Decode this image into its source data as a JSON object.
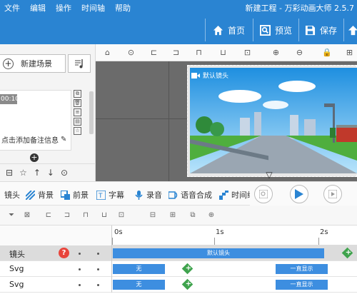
{
  "menu": [
    "文件",
    "编辑",
    "操作",
    "时间轴",
    "帮助"
  ],
  "window_title": "新建工程 - 万彩动画大师 2.5.7",
  "top_buttons": {
    "home": "首页",
    "preview": "预览",
    "save": "保存"
  },
  "left_panel": {
    "new_scene": "新建场景",
    "scene_time": "00:10",
    "note_hint": "点击添加备注信息"
  },
  "canvas": {
    "lens_label": "默认镜头"
  },
  "tabs": [
    "镜头",
    "背景",
    "前景",
    "字幕",
    "录音",
    "语音合成",
    "时间缩"
  ],
  "ruler": {
    "marks": [
      "0s",
      "1s",
      "2s"
    ]
  },
  "tracks": [
    {
      "name": "镜头",
      "bar_label": "默认镜头"
    },
    {
      "name": "Svg",
      "bar1": "无",
      "bar2": "一直显示"
    },
    {
      "name": "Svg",
      "bar1": "无",
      "bar2": "一直显示"
    }
  ],
  "colors": {
    "accent": "#2a84d2",
    "track_bar": "#3d8ee0",
    "keyframe": "#3fa34d",
    "help": "#e8453c"
  }
}
